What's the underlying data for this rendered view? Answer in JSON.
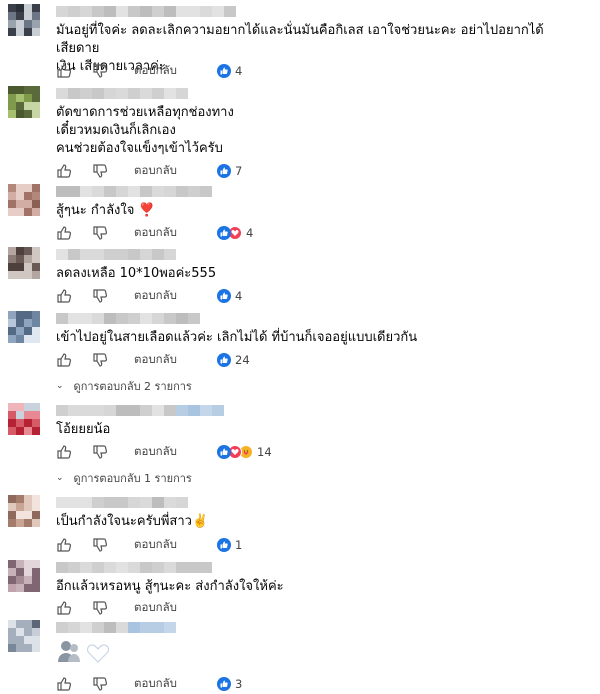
{
  "reply_label": "ตอบกลับ",
  "comments": [
    {
      "text": "มันอยู่ที่ใจค่ะ ลดละเลิกความอยากได้และนั่นมันคือกิเลส เอาใจช่วยนะคะ อย่าไปอยากได้ เสียดาย\nเงิน เสียดายเวลาค่ะ",
      "reaction_count": "4",
      "reactions": [
        "like"
      ]
    },
    {
      "text": "ตัดขาดการช่วยเหลือทุกช่องทาง\nเดี๋ยวหมดเงินก็เลิกเอง\nคนช่วยต้องใจแข็งๆเข้าไว้ครับ",
      "reaction_count": "7",
      "reactions": [
        "like"
      ]
    },
    {
      "text": "สู้ๆนะ กำลังใจ",
      "emoji": "❣️",
      "reaction_count": "4",
      "reactions": [
        "like",
        "love"
      ]
    },
    {
      "text": "ลดลงเหลือ 10*10พอค่ะ555",
      "reaction_count": "4",
      "reactions": [
        "like"
      ]
    },
    {
      "text": "เข้าไปอยู่ในสายเลือดแล้วค่ะ เลิกไม่ได้ ที่บ้านก็เจออยู่แบบเดียวกัน",
      "reaction_count": "24",
      "reactions": [
        "like"
      ],
      "replies_label": "ดูการตอบกลับ 2 รายการ"
    },
    {
      "text": "โอ้ยยยน้อ",
      "reaction_count": "14",
      "reactions": [
        "like",
        "love",
        "care"
      ],
      "replies_label": "ดูการตอบกลับ 1 รายการ"
    },
    {
      "text": "เป็นกำลังใจนะครับพี่สาว",
      "emoji": "✌️",
      "reaction_count": "1",
      "reactions": [
        "like"
      ]
    },
    {
      "text": "อีกแล้วเหรอหนู สู้ๆนะคะ ส่งกำลังใจให้ค่ะ",
      "reaction_count": "",
      "reactions": []
    },
    {
      "text": "",
      "sticker": true,
      "reaction_count": "3",
      "reactions": [
        "like"
      ]
    }
  ],
  "colors": {
    "like": "#1b74e4",
    "love": "#f33e58",
    "care": "#f7b125"
  }
}
